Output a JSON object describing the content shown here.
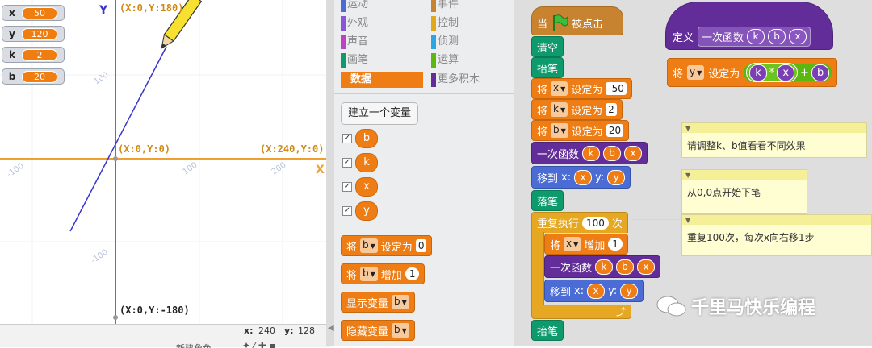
{
  "stage": {
    "monitors": [
      {
        "name": "x",
        "value": "50"
      },
      {
        "name": "y",
        "value": "120"
      },
      {
        "name": "k",
        "value": "2"
      },
      {
        "name": "b",
        "value": "20"
      }
    ],
    "axis_x": "X",
    "axis_y": "Y",
    "coord_top": "(X:0,Y:180)",
    "coord_origin": "(X:0,Y:0)",
    "coord_right": "(X:240,Y:0)",
    "coord_bottom": "(X:0,Y:-180)",
    "ticks": {
      "y100": "100",
      "ym100": "-100",
      "xm100": "-100",
      "x100": "100",
      "x200": "200"
    },
    "colors": {
      "axis_x": "#f0a030",
      "axis_y": "#3a36c8",
      "line": "#3a36c8",
      "pencil": "#f8e030"
    }
  },
  "status": {
    "x_label": "x:",
    "x_value": "240",
    "y_label": "y:",
    "y_value": "128",
    "sprite_label": "新建角色"
  },
  "palette": {
    "categories_left": [
      "运动",
      "外观",
      "声音",
      "画笔",
      "数据"
    ],
    "categories_right": [
      "事件",
      "控制",
      "侦测",
      "运算",
      "更多积木"
    ],
    "selected": "数据",
    "make_var_button": "建立一个变量",
    "variables": [
      "b",
      "k",
      "x",
      "y"
    ],
    "check": "✓",
    "blocks": {
      "set_label": "将",
      "set_var": "b",
      "set_mid": "设定为",
      "set_value": "0",
      "change_label": "将",
      "change_var": "b",
      "change_mid": "增加",
      "change_value": "1",
      "show_label": "显示变量",
      "show_var": "b",
      "hide_label": "隐藏变量",
      "hide_var": "b"
    }
  },
  "script": {
    "hat_when": "当",
    "hat_clicked": "被点击",
    "clear": "清空",
    "pen_up": "抬笔",
    "set_x": {
      "label": "将",
      "var": "x",
      "mid": "设定为",
      "value": "-50"
    },
    "set_k": {
      "label": "将",
      "var": "k",
      "mid": "设定为",
      "value": "2"
    },
    "set_b": {
      "label": "将",
      "var": "b",
      "mid": "设定为",
      "value": "20"
    },
    "call_func": {
      "name": "一次函数",
      "args": [
        "k",
        "b",
        "x"
      ]
    },
    "goto": {
      "label": "移到",
      "x_label": "x:",
      "x_var": "x",
      "y_label": "y:",
      "y_var": "y"
    },
    "pen_down": "落笔",
    "repeat": {
      "label": "重复执行",
      "count": "100",
      "unit": "次"
    },
    "change_x": {
      "label": "将",
      "var": "x",
      "mid": "增加",
      "value": "1"
    },
    "call_func2": {
      "name": "一次函数",
      "args": [
        "k",
        "b",
        "x"
      ]
    },
    "goto2": {
      "label": "移到",
      "x_label": "x:",
      "x_var": "x",
      "y_label": "y:",
      "y_var": "y"
    },
    "loop_arrow": "⤴",
    "pen_up2": "抬笔"
  },
  "define": {
    "label": "定义",
    "func": "一次函数",
    "args": [
      "k",
      "b",
      "x"
    ],
    "set_label": "将",
    "set_var": "y",
    "set_mid": "设定为",
    "expr": {
      "a": "k",
      "op1": "*",
      "b": "x",
      "op2": "+",
      "c": "b"
    }
  },
  "comments": [
    "请调整k、b值看看不同效果",
    "从0,0点开始下笔",
    "重复100次，每次x向右移1步"
  ],
  "watermark": "千里马快乐编程"
}
